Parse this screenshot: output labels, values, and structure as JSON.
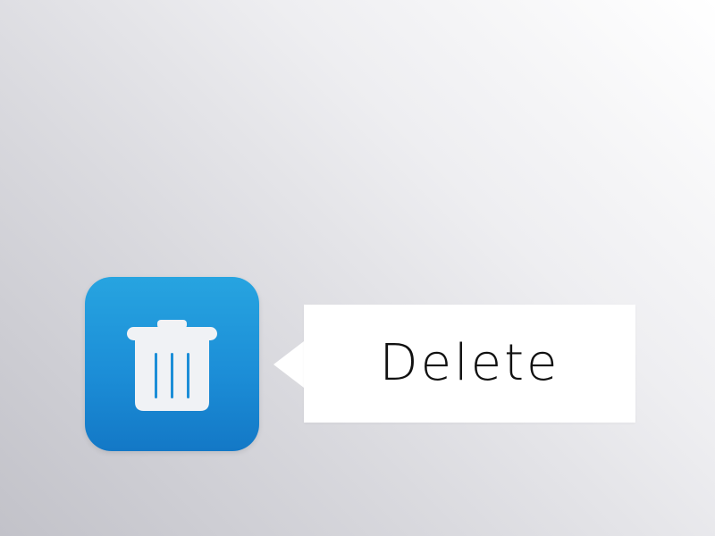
{
  "delete_action": {
    "icon": "trash-icon",
    "accent_color": "#1c8ed7",
    "tooltip_label": "Delete"
  }
}
